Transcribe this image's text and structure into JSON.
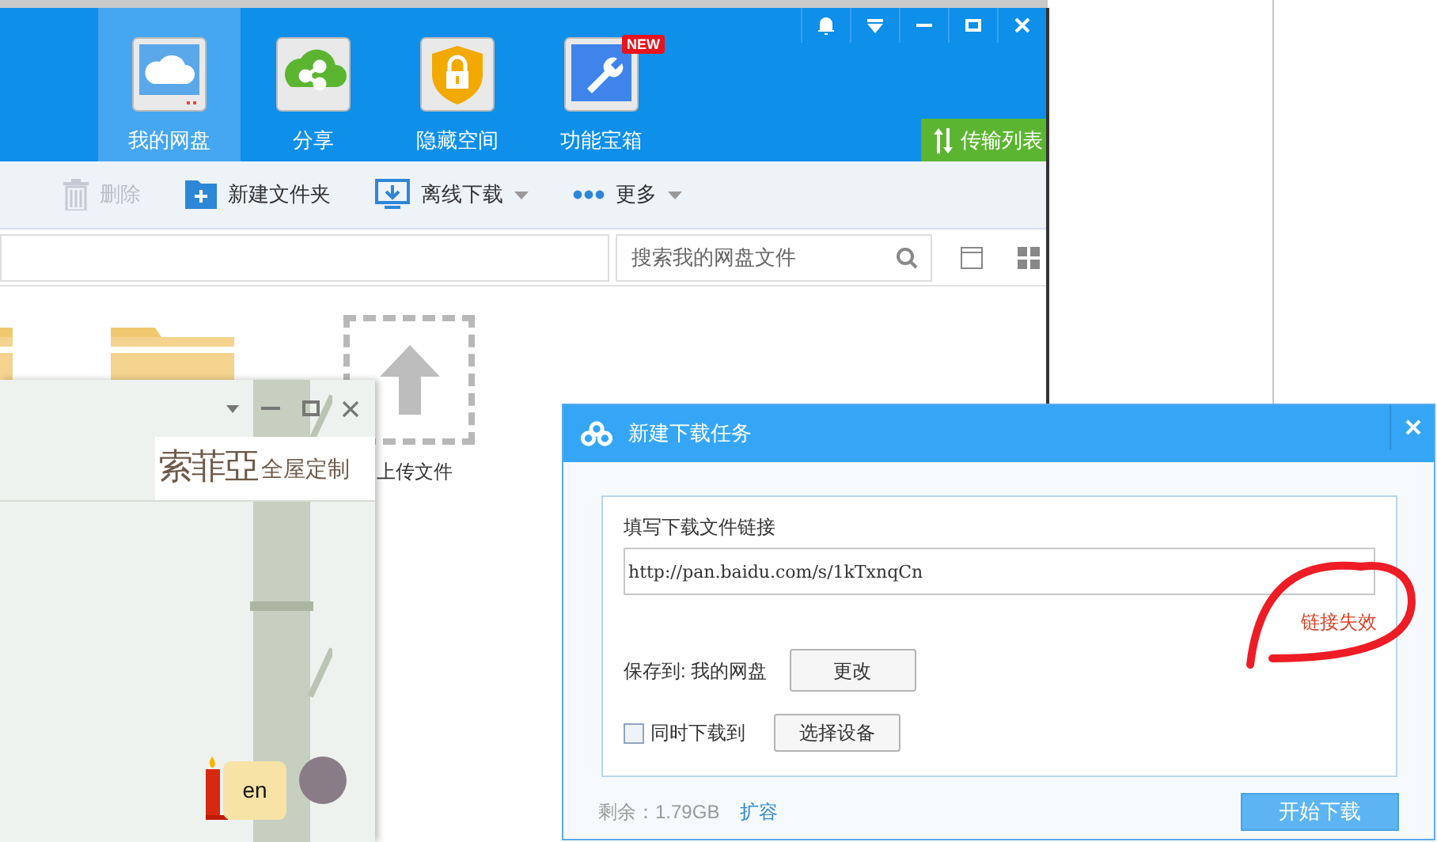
{
  "main_window": {
    "nav_tabs": [
      {
        "kind": "cloud",
        "label": "我的网盘",
        "selected": true
      },
      {
        "kind": "share",
        "label": "分享",
        "selected": false
      },
      {
        "kind": "lock",
        "label": "隐藏空间",
        "selected": false
      },
      {
        "kind": "tools",
        "label": "功能宝箱",
        "selected": false,
        "badge": "NEW"
      }
    ],
    "transfer_button": "传输列表",
    "toolbar": [
      {
        "kind": "delete",
        "label": "删除",
        "disabled": true,
        "dropdown": false
      },
      {
        "kind": "new-folder",
        "label": "新建文件夹",
        "disabled": false,
        "dropdown": false
      },
      {
        "kind": "offline-download",
        "label": "离线下载",
        "disabled": false,
        "dropdown": true
      },
      {
        "kind": "more",
        "label": "更多",
        "disabled": false,
        "dropdown": true
      }
    ],
    "search": {
      "placeholder": "搜索我的网盘文件"
    },
    "upload_tile": "上传文件"
  },
  "chat_window": {
    "logo": "索菲亞",
    "logo_subtitle": "全屋定制",
    "message": "en"
  },
  "dialog": {
    "title": "新建下载任务",
    "link_label": "填写下载文件链接",
    "link_value": "http://pan.baidu.com/s/1kTxnqCn",
    "link_error": "链接失效",
    "save_to": "保存到: 我的网盘",
    "change_button": "更改",
    "also_download": {
      "label": "同时下载到",
      "checked": false
    },
    "choose_device_button": "选择设备",
    "remaining": "剩余：1.79GB",
    "expand_link": "扩容",
    "start_button": "开始下载"
  }
}
